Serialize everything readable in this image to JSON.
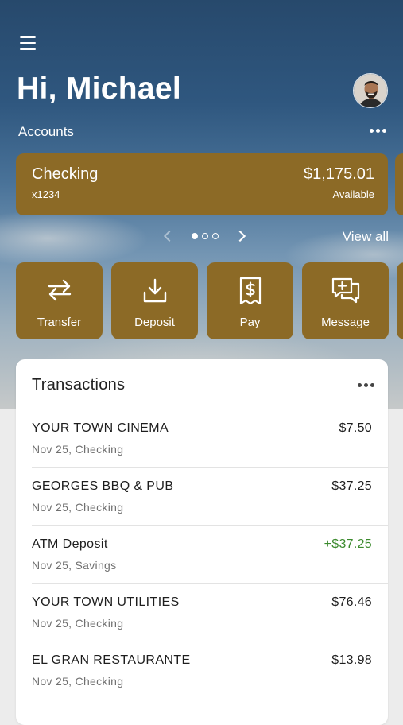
{
  "header": {
    "greeting": "Hi, Michael",
    "accounts_label": "Accounts"
  },
  "account": {
    "name": "Checking",
    "number": "x1234",
    "balance": "$1,175.01",
    "balance_label": "Available"
  },
  "pager": {
    "pages": 3,
    "active": 1,
    "view_all": "View all"
  },
  "actions": [
    {
      "label": "Transfer",
      "icon": "transfer-icon"
    },
    {
      "label": "Deposit",
      "icon": "deposit-icon"
    },
    {
      "label": "Pay",
      "icon": "pay-icon"
    },
    {
      "label": "Message",
      "icon": "message-icon"
    }
  ],
  "transactions": {
    "title": "Transactions",
    "items": [
      {
        "name": "YOUR TOWN CINEMA",
        "sub": "Nov 25, Checking",
        "amount": "$7.50",
        "positive": false
      },
      {
        "name": "GEORGES BBQ & PUB",
        "sub": "Nov 25, Checking",
        "amount": "$37.25",
        "positive": false
      },
      {
        "name": "ATM Deposit",
        "sub": "Nov 25, Savings",
        "amount": "+$37.25",
        "positive": true
      },
      {
        "name": "YOUR TOWN UTILITIES",
        "sub": "Nov 25, Checking",
        "amount": "$76.46",
        "positive": false
      },
      {
        "name": "EL GRAN RESTAURANTE",
        "sub": "Nov 25, Checking",
        "amount": "$13.98",
        "positive": false
      }
    ]
  },
  "colors": {
    "tile": "#8c6a26",
    "positive_amount": "#3b8a2d"
  }
}
